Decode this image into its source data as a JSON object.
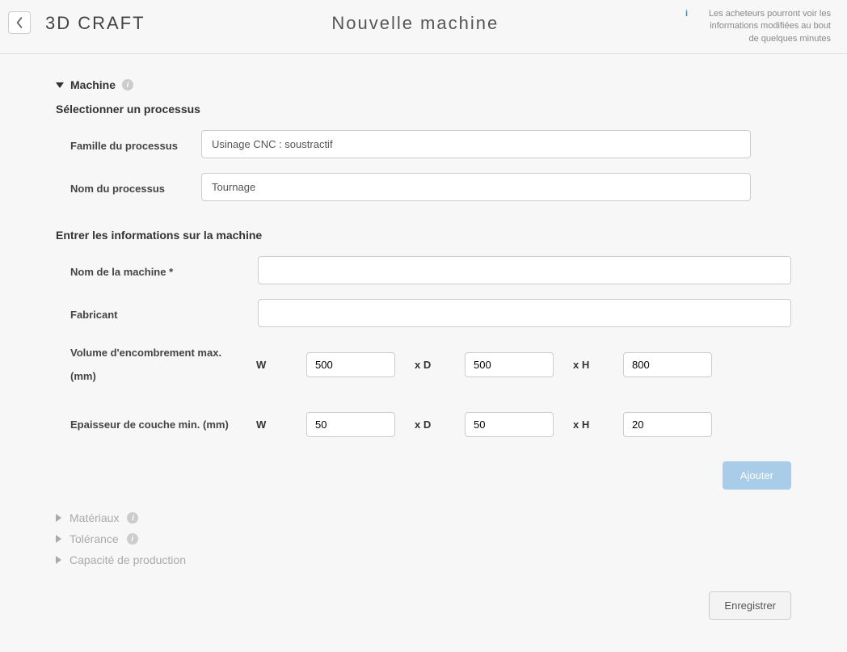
{
  "header": {
    "brand": "3D CRAFT",
    "title": "Nouvelle machine",
    "notice": "Les acheteurs pourront voir les informations modifiées au bout de quelques minutes"
  },
  "sections": {
    "machine": {
      "label": "Machine"
    },
    "materiaux": {
      "label": "Matériaux"
    },
    "tolerance": {
      "label": "Tolérance"
    },
    "capacite": {
      "label": "Capacité de production"
    }
  },
  "form": {
    "select_process_head": "Sélectionner un processus",
    "family_label": "Famille du processus",
    "family_value": "Usinage CNC : soustractif",
    "process_name_label": "Nom du processus",
    "process_name_value": "Tournage",
    "machine_info_head": "Entrer les informations sur la machine",
    "machine_name_label": "Nom de la machine *",
    "machine_name_value": "",
    "manufacturer_label": "Fabricant",
    "manufacturer_value": "",
    "volume_label": "Volume d'encombrement max. (mm)",
    "layer_label": "Epaisseur de couche min. (mm)",
    "dim_W": "W",
    "dim_D": "x D",
    "dim_H": "x H",
    "volume": {
      "w": "500",
      "d": "500",
      "h": "800"
    },
    "layer": {
      "w": "50",
      "d": "50",
      "h": "20"
    },
    "add_button": "Ajouter",
    "save_button": "Enregistrer"
  }
}
